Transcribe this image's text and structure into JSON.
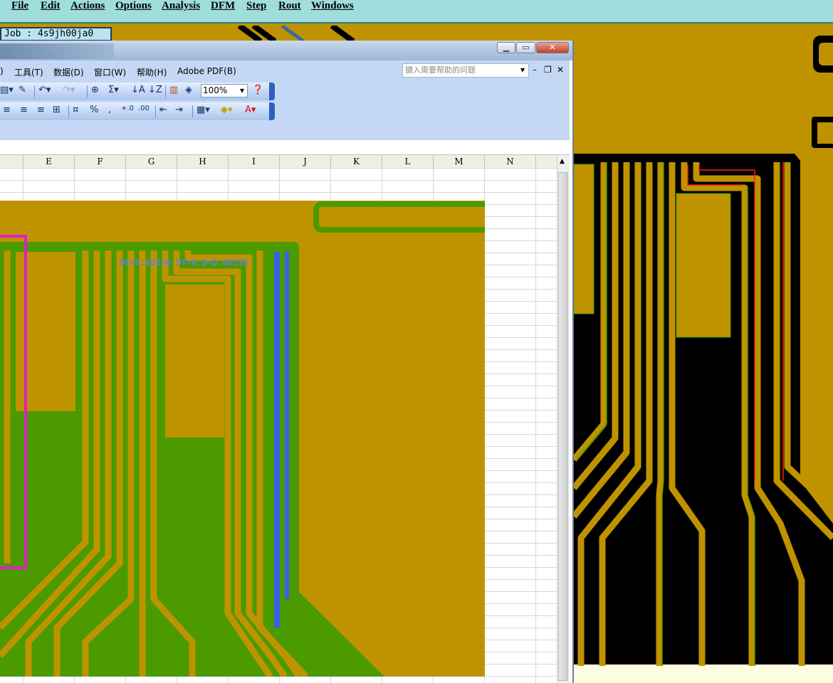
{
  "app_menu": {
    "items": [
      "File",
      "Edit",
      "Actions",
      "Options",
      "Analysis",
      "DFM",
      "Step",
      "Rout",
      "Windows"
    ]
  },
  "job": {
    "label": "Job : 4s9jh00ja0"
  },
  "excel": {
    "menu": [
      "工具(T)",
      "数据(D)",
      "窗口(W)",
      "帮助(H)",
      "Adobe PDF(B)"
    ],
    "menu_partial": ")",
    "help_placeholder": "键入需要帮助的问题",
    "zoom": "100%",
    "columns": [
      "E",
      "F",
      "G",
      "H",
      "I",
      "J",
      "K",
      "L",
      "M",
      "N"
    ]
  },
  "measurement": "DX=0.00256,DY=0,D=0.00256",
  "colors": {
    "board": "#bf9300",
    "copper": "#4a9a00",
    "trace": "#bf9300",
    "background": "#000000",
    "highlight": "#e11ec8",
    "selected": "#3b5fe8",
    "red_outline": "#ff1a1a"
  },
  "icons": [
    "minimize-icon",
    "restore-icon",
    "close-icon"
  ]
}
